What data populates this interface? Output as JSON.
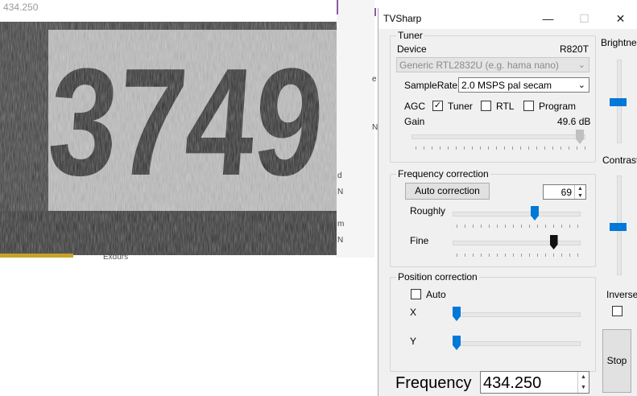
{
  "video_window": {
    "title": "434.250",
    "plate_text": "3749",
    "bg_text": "Exdurs",
    "bg_fragments": [
      "e",
      "N",
      "d",
      "N",
      "m",
      "N"
    ]
  },
  "app": {
    "title": "TVSharp",
    "window_controls": {
      "minimize": "—",
      "maximize": "☐",
      "close": "✕"
    },
    "tuner": {
      "group_label": "Tuner",
      "device_label": "Device",
      "device_model": "R820T",
      "device_select": "Generic RTL2832U (e.g. hama nano)",
      "samplerate_label": "SampleRate",
      "samplerate_value": "2.0 MSPS pal secam",
      "agc_label": "AGC",
      "agc_tuner_label": "Tuner",
      "agc_tuner_checked": true,
      "agc_rtl_label": "RTL",
      "agc_rtl_checked": false,
      "agc_program_label": "Program",
      "agc_program_checked": false,
      "gain_label": "Gain",
      "gain_value": "49.6 dB",
      "gain_level": 1.0
    },
    "frequency_correction": {
      "group_label": "Frequency correction",
      "auto_button": "Auto correction",
      "value": "69",
      "roughly_label": "Roughly",
      "roughly_level": 0.66,
      "fine_label": "Fine",
      "fine_level": 0.82
    },
    "position_correction": {
      "group_label": "Position correction",
      "auto_label": "Auto",
      "auto_checked": false,
      "x_label": "X",
      "x_level": 0.0,
      "y_label": "Y",
      "y_level": 0.0
    },
    "frequency": {
      "label": "Frequency",
      "value": "434.250"
    },
    "side": {
      "brightness_label": "Brightnes",
      "brightness_level": 0.52,
      "contrast_label": "Contrast",
      "contrast_level": 0.53,
      "inverse_label": "Inverse",
      "inverse_checked": false,
      "stop_button": "Stop"
    },
    "colors": {
      "accent": "#0078d7",
      "window_bg": "#f0f0f0"
    }
  }
}
